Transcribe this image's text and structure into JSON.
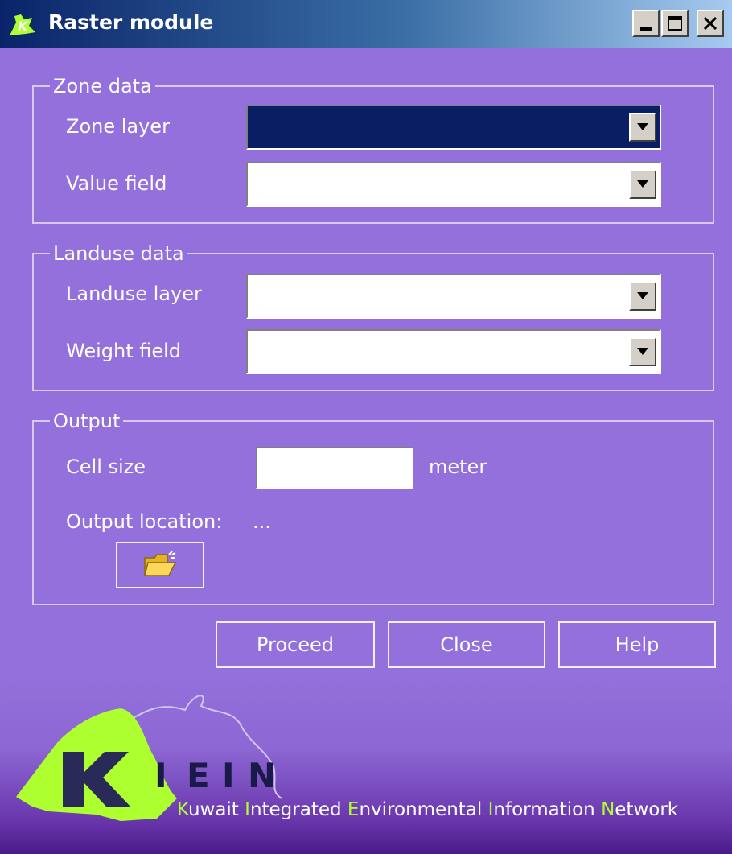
{
  "window": {
    "title": "Raster module"
  },
  "zone_group": {
    "legend": "Zone data",
    "zone_layer_label": "Zone layer",
    "zone_layer_value": "",
    "value_field_label": "Value field",
    "value_field_value": ""
  },
  "landuse_group": {
    "legend": "Landuse data",
    "landuse_layer_label": "Landuse layer",
    "landuse_layer_value": "",
    "weight_field_label": "Weight field",
    "weight_field_value": ""
  },
  "output_group": {
    "legend": "Output",
    "cell_size_label": "Cell size",
    "cell_size_value": "",
    "cell_size_unit": "meter",
    "output_location_label": "Output location:",
    "output_location_value": "..."
  },
  "buttons": {
    "proceed": "Proceed",
    "close": "Close",
    "help": "Help"
  },
  "banner": {
    "logo_letters": [
      "I",
      "E",
      "I",
      "N"
    ],
    "tagline_words": [
      {
        "initial": "K",
        "rest": "uwait "
      },
      {
        "initial": "I",
        "rest": "ntegrated "
      },
      {
        "initial": "E",
        "rest": "nvironmental "
      },
      {
        "initial": "I",
        "rest": "nformation "
      },
      {
        "initial": "N",
        "rest": "etwork"
      }
    ]
  },
  "colors": {
    "dialog_bg": "#9370db",
    "selected_combo": "#0a1f63",
    "logo_green": "#adff2f",
    "logo_letters": "#1a1a4a"
  },
  "icons": {
    "app": "kiein-logo-icon",
    "minimize": "minimize-icon",
    "maximize": "maximize-icon",
    "close": "close-icon",
    "dropdown": "chevron-down-icon",
    "folder": "folder-open-icon"
  }
}
